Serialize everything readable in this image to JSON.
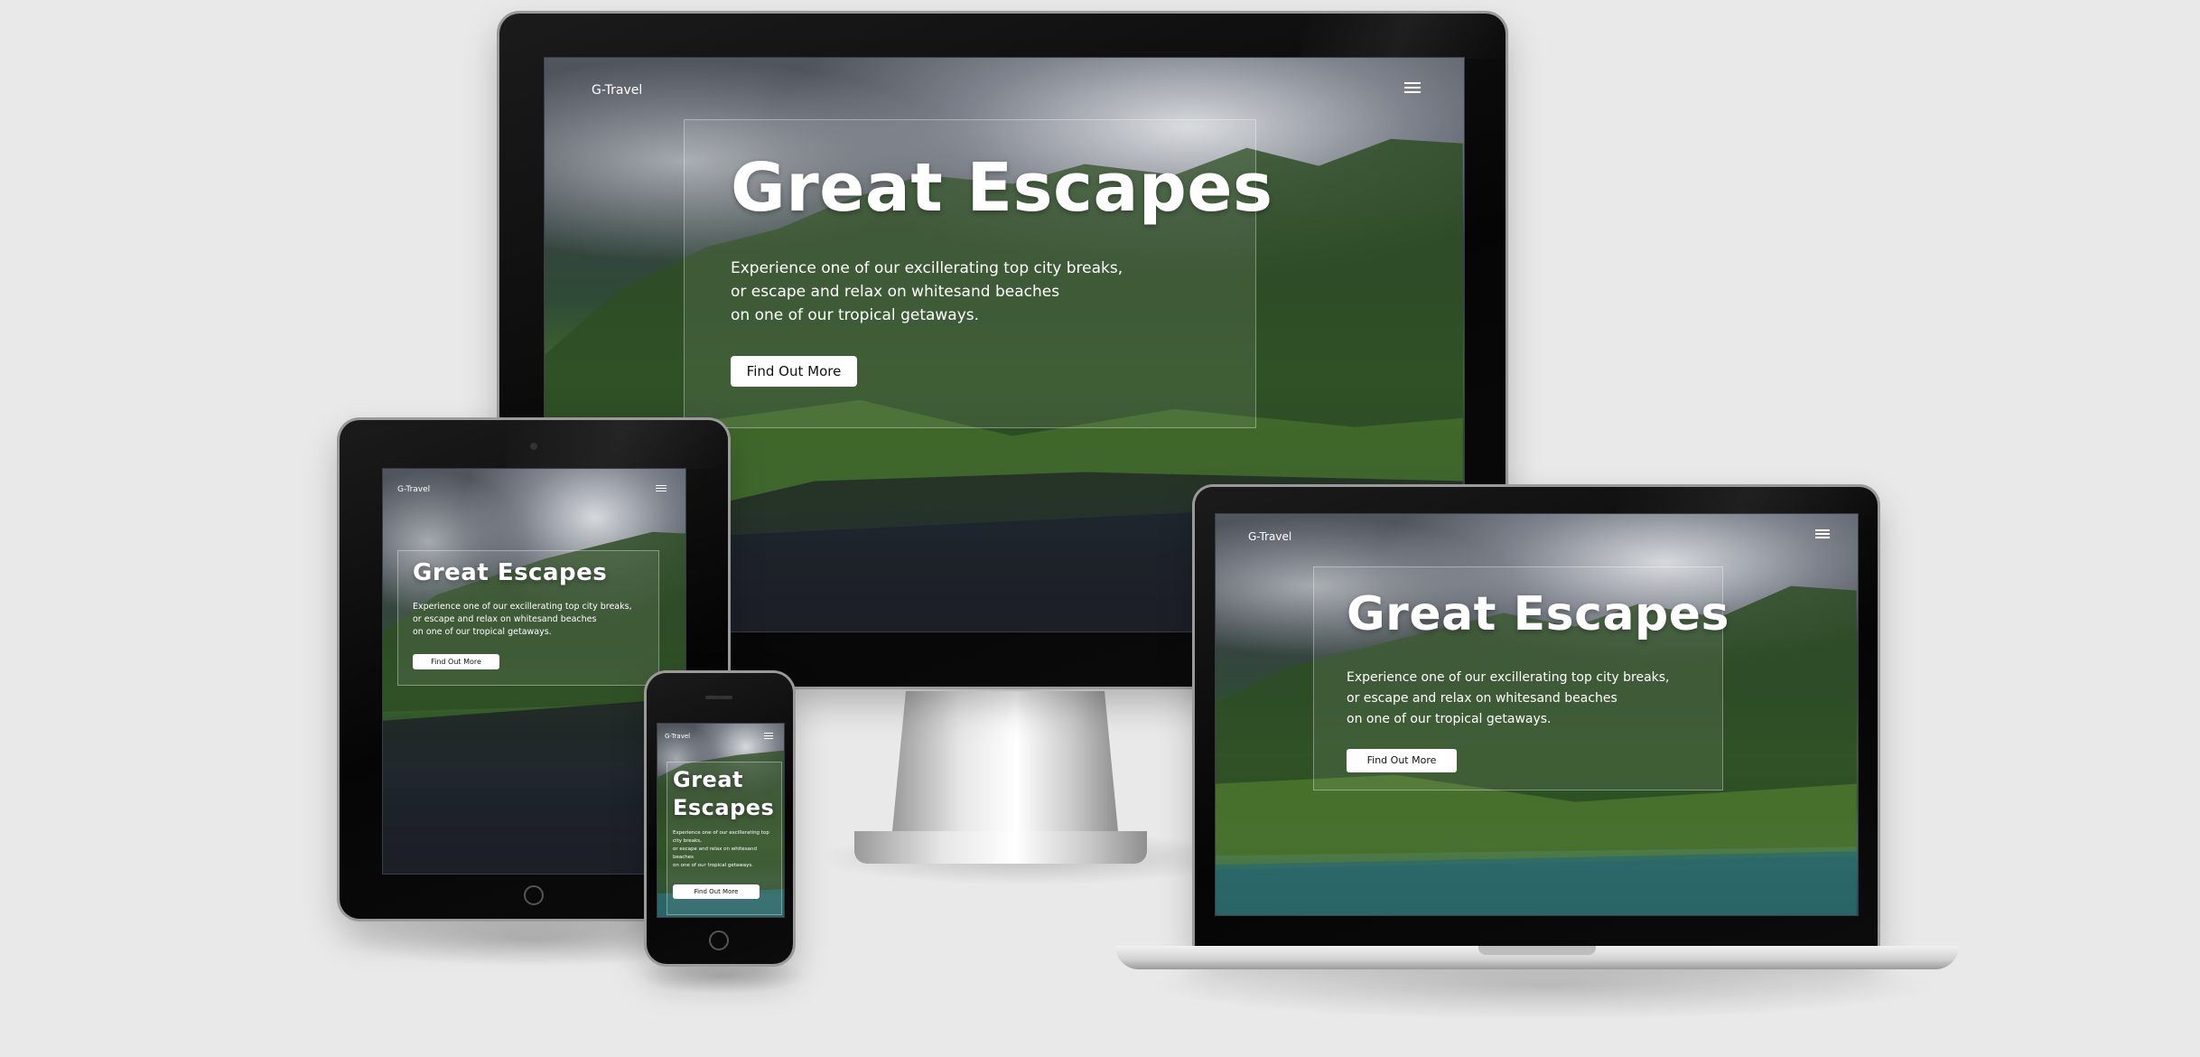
{
  "colors": {
    "page_bg": "#e9e9e9",
    "hero_text": "#ffffff",
    "button_bg": "#ffffff",
    "button_text": "#111111",
    "bezel": "#0a0a0a"
  },
  "site": {
    "logo": "G-Travel",
    "hero_title": "Great Escapes",
    "hero_title_line1": "Great",
    "hero_title_line2": "Escapes",
    "blurb_line1": "Experience one of our excillerating top city breaks,",
    "blurb_line2": "or escape and relax on whitesand beaches",
    "blurb_line3": "on one of our tropical getaways.",
    "button_label": "Find Out More",
    "menu_icon": "hamburger-menu-icon"
  },
  "phone_blurb": {
    "line1": "Experience one of our excillerating top",
    "line2": "city breaks,",
    "line3": "or escape and relax on whitesand",
    "line4": "beaches",
    "line5": "on one of our tropical getaways."
  },
  "devices": [
    "desktop",
    "tablet",
    "phone",
    "laptop"
  ]
}
